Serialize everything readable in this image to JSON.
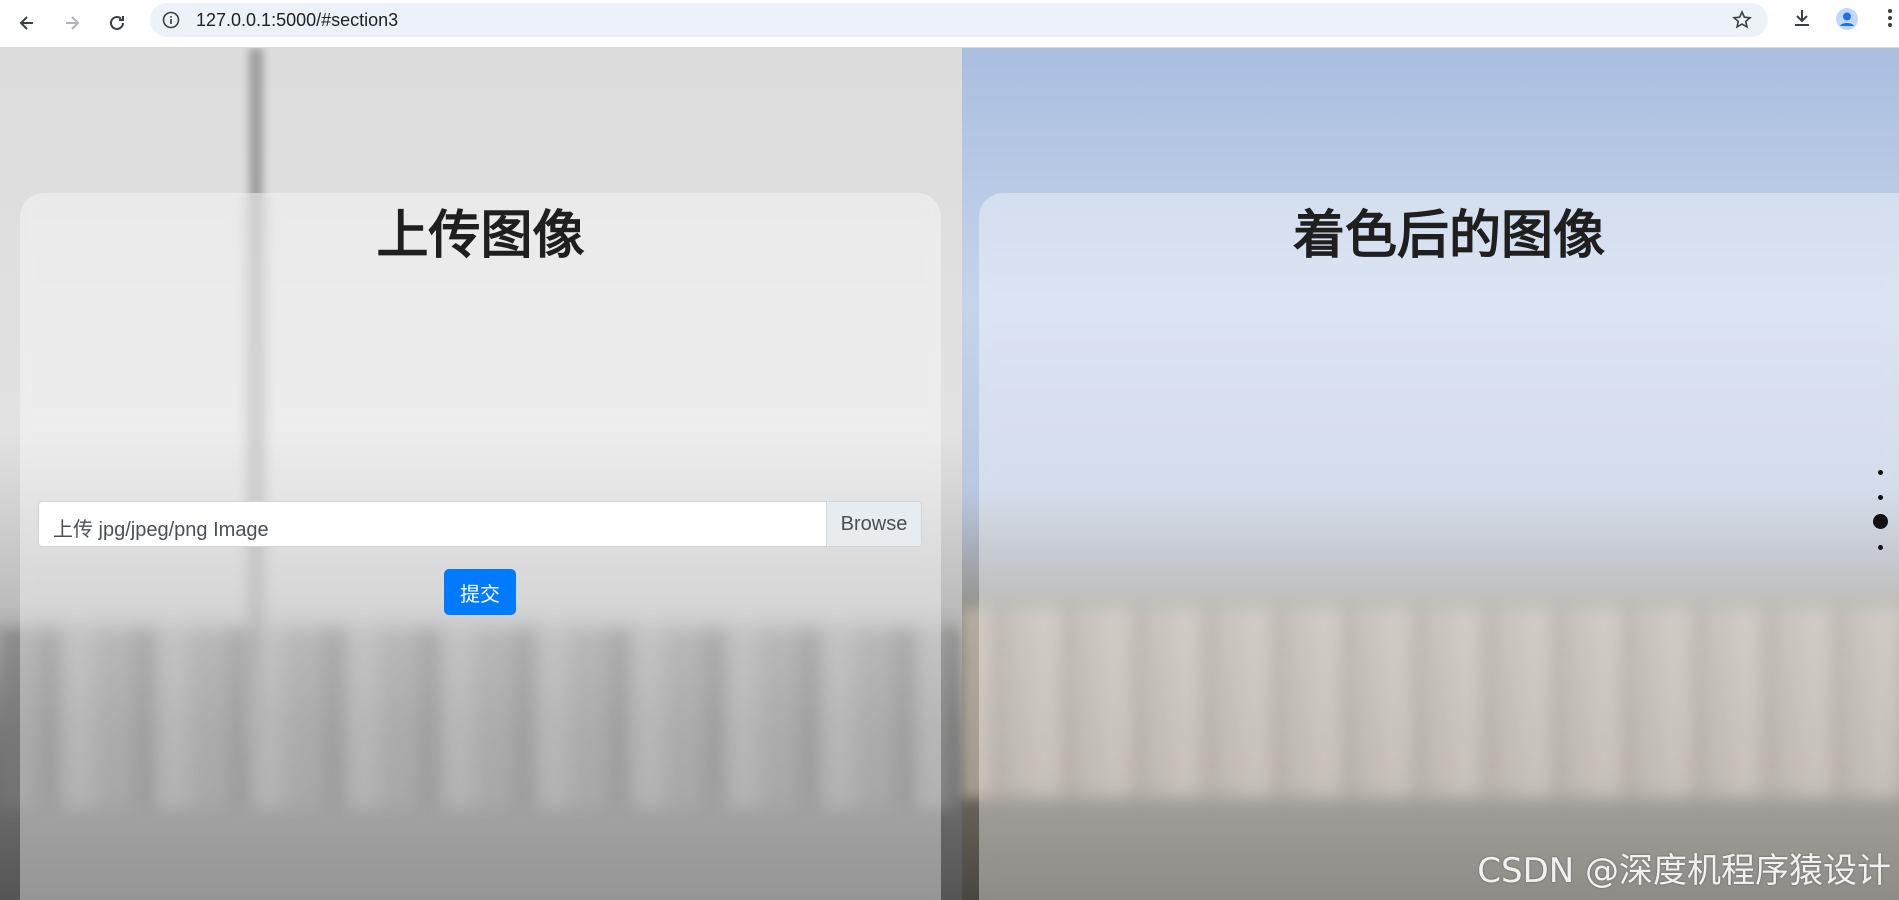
{
  "browser": {
    "url": "127.0.0.1:5000/#section3"
  },
  "left_panel": {
    "title": "上传图像",
    "file_input_label": "上传 jpg/jpeg/png Image",
    "browse_label": "Browse",
    "submit_label": "提交"
  },
  "right_panel": {
    "title": "着色后的图像"
  },
  "section_nav": {
    "count": 4,
    "active_index": 3
  },
  "watermark": "CSDN @深度机程序猿设计",
  "icons": {
    "back": "back-arrow-icon",
    "forward": "forward-arrow-icon",
    "reload": "reload-icon",
    "info": "info-icon",
    "bookmark": "star-icon",
    "download": "download-icon",
    "profile": "profile-icon",
    "menu": "more-vert-icon"
  },
  "colors": {
    "primary_button": "#007bff"
  }
}
